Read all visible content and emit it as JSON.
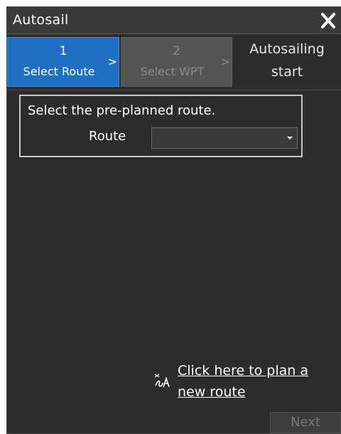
{
  "window": {
    "title": "Autosail",
    "close_icon": "close-icon"
  },
  "steps": [
    {
      "number": "1",
      "label": "Select Route",
      "arrow": ">",
      "state": "active"
    },
    {
      "number": "2",
      "label": "Select WPT",
      "arrow": ">",
      "state": "disabled"
    },
    {
      "line1": "Autosailing",
      "line2": "start",
      "state": "inactive"
    }
  ],
  "route_panel": {
    "instruction": "Select the pre-planned route.",
    "route_label": "Route",
    "route_value": "",
    "dropdown_icon": "chevron-down-icon"
  },
  "plan_link": {
    "icon": "route-plan-icon",
    "text": "Click here to plan a new route"
  },
  "footer": {
    "next_label": "Next"
  },
  "colors": {
    "background": "#2c2c2c",
    "titlebar": "#3a3a3a",
    "active_step": "#1f6fc3",
    "disabled_step": "#555555",
    "box_border": "#c9c9c9",
    "next_disabled_text": "#777777"
  }
}
